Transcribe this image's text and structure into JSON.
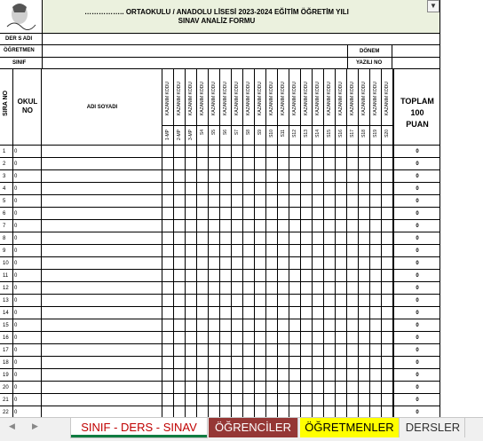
{
  "header": {
    "title_line1": "…………….. ORTAOKULU / ANADOLU LİSESİ 2023-2024 EĞİTİM ÖĞRETİM YILI",
    "title_line2": "SINAV ANALİZ FORMU",
    "dropdown_icon": "chevron-down-icon"
  },
  "form": {
    "ders_adi_label": "DER S ADI",
    "ogretmen_label": "ÖĞRETMEN",
    "sinif_label": "SINIF",
    "donem_label": "DÖNEM",
    "yazili_no_label": "YAZILI NO"
  },
  "table": {
    "sira_no": "SIRA NO",
    "okul_no": "OKUL NO",
    "adi_soyadi": "ADI SOYADI",
    "kazanim": "KAZANIM KODU",
    "toplam": "TOPLAM",
    "toplam_puan": "100",
    "puan": "PUAN",
    "questions": [
      "1-MP",
      "2-MP",
      "3-MP",
      "S4",
      "S5",
      "S6",
      "S7",
      "S8",
      "S9",
      "S10",
      "S11",
      "S12",
      "S13",
      "S14",
      "S15",
      "S16",
      "S17",
      "S18",
      "S19",
      "S20"
    ],
    "rows": [
      {
        "n": "1",
        "okul": "0",
        "total": "0"
      },
      {
        "n": "2",
        "okul": "0",
        "total": "0"
      },
      {
        "n": "3",
        "okul": "0",
        "total": "0"
      },
      {
        "n": "4",
        "okul": "0",
        "total": "0"
      },
      {
        "n": "5",
        "okul": "0",
        "total": "0"
      },
      {
        "n": "6",
        "okul": "0",
        "total": "0"
      },
      {
        "n": "7",
        "okul": "0",
        "total": "0"
      },
      {
        "n": "8",
        "okul": "0",
        "total": "0"
      },
      {
        "n": "9",
        "okul": "0",
        "total": "0"
      },
      {
        "n": "10",
        "okul": "0",
        "total": "0"
      },
      {
        "n": "11",
        "okul": "0",
        "total": "0"
      },
      {
        "n": "12",
        "okul": "0",
        "total": "0"
      },
      {
        "n": "13",
        "okul": "0",
        "total": "0"
      },
      {
        "n": "14",
        "okul": "0",
        "total": "0"
      },
      {
        "n": "15",
        "okul": "0",
        "total": "0"
      },
      {
        "n": "16",
        "okul": "0",
        "total": "0"
      },
      {
        "n": "17",
        "okul": "0",
        "total": "0"
      },
      {
        "n": "18",
        "okul": "0",
        "total": "0"
      },
      {
        "n": "19",
        "okul": "0",
        "total": "0"
      },
      {
        "n": "20",
        "okul": "0",
        "total": "0"
      },
      {
        "n": "21",
        "okul": "0",
        "total": "0"
      },
      {
        "n": "22",
        "okul": "0",
        "total": "0"
      }
    ]
  },
  "tabs": [
    {
      "label": "SINIF - DERS - SINAV",
      "bg": "#ffffff",
      "fg": "#c00000",
      "active": true
    },
    {
      "label": "ÖĞRENCİLER",
      "bg": "#953735",
      "fg": "#ffffff",
      "active": false
    },
    {
      "label": "ÖĞRETMENLER",
      "bg": "#ffff00",
      "fg": "#000000",
      "active": false
    },
    {
      "label": "DERSLER",
      "bg": "#f0f0f0",
      "fg": "#333333",
      "active": false
    }
  ],
  "nav": {
    "prev": "◀",
    "next": "▶"
  },
  "colors": {
    "header_bg": "#ebf1de",
    "grid": "#000000"
  }
}
